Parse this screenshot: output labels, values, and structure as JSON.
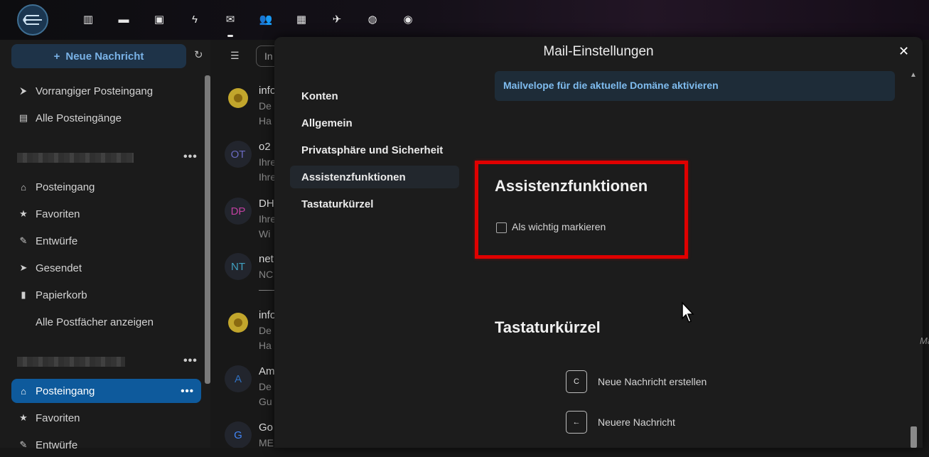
{
  "topbar": {
    "apps": [
      {
        "name": "dashboard-icon",
        "glyph": "▥",
        "active": false
      },
      {
        "name": "files-icon",
        "glyph": "▬",
        "active": false
      },
      {
        "name": "photos-icon",
        "glyph": "▣",
        "active": false
      },
      {
        "name": "activity-icon",
        "glyph": "ϟ",
        "active": false
      },
      {
        "name": "mail-icon",
        "glyph": "✉",
        "active": true
      },
      {
        "name": "contacts-icon",
        "glyph": "👥",
        "active": false
      },
      {
        "name": "calendar-icon",
        "glyph": "▦",
        "active": false
      },
      {
        "name": "news-icon",
        "glyph": "✈",
        "active": false
      },
      {
        "name": "web-icon",
        "glyph": "◍",
        "active": false
      },
      {
        "name": "circle-icon",
        "glyph": "◉",
        "active": false
      }
    ]
  },
  "sidebar": {
    "new_message": "Neue Nachricht",
    "unified": [
      {
        "icon": "⮞",
        "label": "Vorrangiger Posteingang"
      },
      {
        "icon": "▤",
        "label": "Alle Posteingänge"
      }
    ],
    "account1_items": [
      {
        "icon": "⌂",
        "label": "Posteingang"
      },
      {
        "icon": "★",
        "label": "Favoriten"
      },
      {
        "icon": "✎",
        "label": "Entwürfe"
      },
      {
        "icon": "➤",
        "label": "Gesendet"
      },
      {
        "icon": "🗑",
        "label": "Papierkorb"
      },
      {
        "icon": "",
        "label": "Alle Postfächer anzeigen"
      }
    ],
    "account2_items": [
      {
        "icon": "⌂",
        "label": "Posteingang",
        "active": true
      },
      {
        "icon": "★",
        "label": "Favoriten"
      },
      {
        "icon": "✎",
        "label": "Entwürfe"
      }
    ],
    "more": "•••"
  },
  "messagelist": {
    "search_placeholder": "In",
    "rows": [
      {
        "initials": "",
        "color": "#e0c030",
        "l1": "info",
        "l2": "De",
        "l3": "Ha"
      },
      {
        "initials": "OT",
        "color": "#6a6ac0",
        "l1": "o2",
        "l2": "Ihre",
        "l3": "Ihre"
      },
      {
        "initials": "DP",
        "color": "#c040a0",
        "l1": "DH",
        "l2": "Ihre",
        "l3": "Wi"
      },
      {
        "initials": "NT",
        "color": "#40a0c0",
        "l1": "net",
        "l2": "NC",
        "l3": "——"
      },
      {
        "initials": "",
        "color": "#e0c030",
        "l1": "info",
        "l2": "De",
        "l3": "Ha"
      },
      {
        "initials": "A",
        "color": "#3070c0",
        "l1": "Am",
        "l2": "De",
        "l3": "Gu"
      },
      {
        "initials": "G",
        "color": "#4285f4",
        "l1": "Go",
        "l2": "ME",
        "l3": ""
      }
    ]
  },
  "modal": {
    "title": "Mail-Einstellungen",
    "close": "✕",
    "nav": [
      {
        "label": "Konten",
        "active": false
      },
      {
        "label": "Allgemein",
        "active": false
      },
      {
        "label": "Privatsphäre und Sicherheit",
        "active": false
      },
      {
        "label": "Assistenzfunktionen",
        "active": true
      },
      {
        "label": "Tastaturkürzel",
        "active": false
      }
    ],
    "banner": "Mailvelope für die aktuelle Domäne aktivieren",
    "assist_heading": "Assistenzfunktionen",
    "assist_checkbox": "Als wichtig markieren",
    "shortcuts_heading": "Tastaturkürzel",
    "shortcuts": [
      {
        "key": "C",
        "label": "Neue Nachricht erstellen"
      },
      {
        "key": "←",
        "label": "Neuere Nachricht"
      }
    ]
  },
  "edge_text": "Ma",
  "colors": {
    "accent": "#0e5a9c",
    "highlight": "#e00000",
    "banner_text": "#7fbcef"
  }
}
